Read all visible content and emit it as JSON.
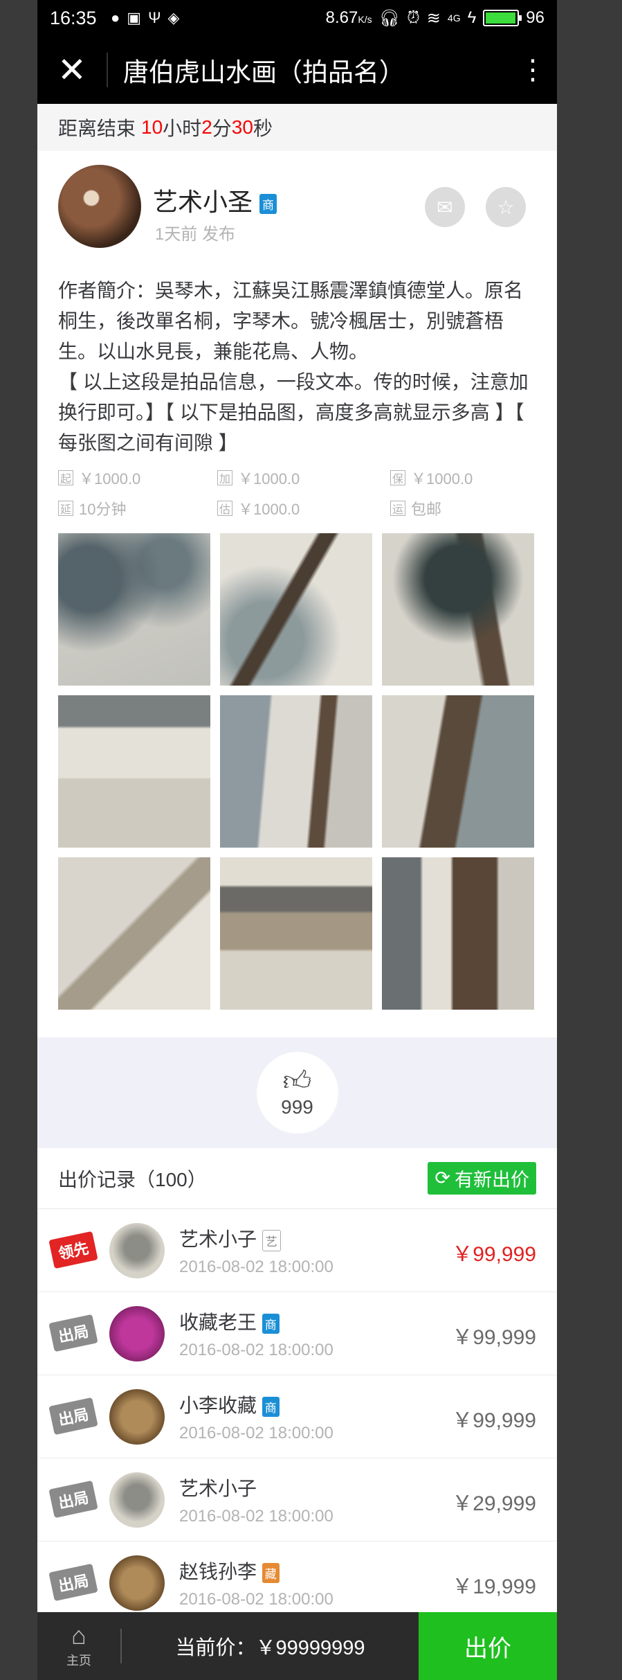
{
  "status_bar": {
    "time": "16:35",
    "speed": "8.67",
    "speed_unit": "K/s",
    "network": "4G",
    "battery": "96",
    "battery_level": 0.96
  },
  "nav": {
    "title": "唐伯虎山水画（拍品名）"
  },
  "countdown": {
    "prefix": "距离结束",
    "hours": "10",
    "hours_unit": "小时",
    "minutes": "2",
    "minutes_unit": "分",
    "seconds": "30",
    "seconds_unit": "秒",
    "accent": "#f60404",
    "background": "#f5f5f6"
  },
  "seller": {
    "name": "艺术小圣",
    "badge": "商",
    "time": "1天前 发布",
    "mail_icon": "mail-icon",
    "star_icon": "star-icon"
  },
  "intro": {
    "line1": "作者簡介：吳琴木，江蘇吳江縣震澤鎮慎德堂人。原名桐生，後改單名桐，字琴木。號冷楓居士，別號蒼梧生。以山水見長，兼能花鳥、人物。",
    "line2": "【 以上这段是拍品信息，一段文本。传的时候，注意加换行即可。】【 以下是拍品图，高度多高就显示多高 】【 每张图之间有间隙 】"
  },
  "prices": [
    {
      "box": "起",
      "value": "￥1000.0"
    },
    {
      "box": "加",
      "value": "￥1000.0"
    },
    {
      "box": "保",
      "value": "￥1000.0"
    },
    {
      "box": "延",
      "value": "10分钟"
    },
    {
      "box": "估",
      "value": "￥1000.0"
    },
    {
      "box": "运",
      "value": "包邮"
    }
  ],
  "likes": {
    "count": "999"
  },
  "bids": {
    "label": "出价记录（100）",
    "refresh_button": "有新出价",
    "rows": [
      {
        "badge": "领先",
        "name": "艺术小子",
        "tag": "艺",
        "time": "2016-08-02 18:00:00",
        "price": "￥99,999"
      },
      {
        "badge": "出局",
        "name": "收藏老王",
        "tag": "商",
        "time": "2016-08-02 18:00:00",
        "price": "￥99,999"
      },
      {
        "badge": "出局",
        "name": "小李收藏",
        "tag": "商",
        "time": "2016-08-02 18:00:00",
        "price": "￥99,999"
      },
      {
        "badge": "出局",
        "name": "艺术小子",
        "tag": "",
        "time": "2016-08-02 18:00:00",
        "price": "￥29,999"
      },
      {
        "badge": "出局",
        "name": "赵钱孙李",
        "tag": "藏",
        "time": "2016-08-02 18:00:00",
        "price": "￥19,999"
      }
    ]
  },
  "footer": {
    "home_label": "主页",
    "current_price": "当前价：￥99999999",
    "bid_button": "出价"
  }
}
